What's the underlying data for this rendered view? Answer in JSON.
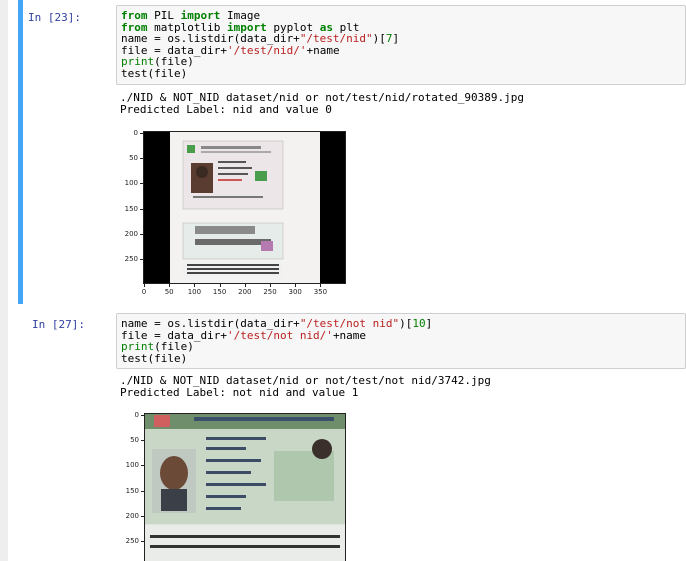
{
  "cells": [
    {
      "prompt": "In [23]:",
      "code_lines": [
        [
          {
            "t": "from",
            "c": "kw"
          },
          {
            "t": " PIL "
          },
          {
            "t": "import",
            "c": "kw"
          },
          {
            "t": " Image"
          }
        ],
        [
          {
            "t": "from",
            "c": "kw"
          },
          {
            "t": " matplotlib "
          },
          {
            "t": "import",
            "c": "kw"
          },
          {
            "t": " pyplot "
          },
          {
            "t": "as",
            "c": "kw"
          },
          {
            "t": " plt"
          }
        ],
        [
          {
            "t": "name = os.listdir(data_dir+"
          },
          {
            "t": "\"/test/nid\"",
            "c": "str"
          },
          {
            "t": ")["
          },
          {
            "t": "7",
            "c": "num"
          },
          {
            "t": "]"
          }
        ],
        [
          {
            "t": "file = data_dir+"
          },
          {
            "t": "'/test/nid/'",
            "c": "str"
          },
          {
            "t": "+name"
          }
        ],
        [
          {
            "t": "print",
            "c": "bi"
          },
          {
            "t": "(file)"
          }
        ],
        [
          {
            "t": "test(file)"
          }
        ]
      ],
      "output_lines": [
        "./NID & NOT_NID dataset/nid or not/test/nid/rotated_90389.jpg",
        "Predicted Label: nid and value 0"
      ],
      "plot": {
        "y_ticks": [
          "0",
          "50",
          "100",
          "150",
          "200",
          "250"
        ],
        "x_ticks": [
          "0",
          "50",
          "100",
          "150",
          "200",
          "250",
          "300",
          "350"
        ],
        "image_desc_icon": "nid-card-image"
      }
    },
    {
      "prompt": "In [27]:",
      "code_lines": [
        [
          {
            "t": "name = os.listdir(data_dir+"
          },
          {
            "t": "\"/test/not nid\"",
            "c": "str"
          },
          {
            "t": ")["
          },
          {
            "t": "10",
            "c": "num"
          },
          {
            "t": "]"
          }
        ],
        [
          {
            "t": "file = data_dir+"
          },
          {
            "t": "'/test/not nid/'",
            "c": "str"
          },
          {
            "t": "+name"
          }
        ],
        [
          {
            "t": "print",
            "c": "bi"
          },
          {
            "t": "(file)"
          }
        ],
        [
          {
            "t": "test(file)"
          }
        ]
      ],
      "output_lines": [
        "./NID & NOT_NID dataset/nid or not/test/not nid/3742.jpg",
        "Predicted Label: not nid and value 1"
      ],
      "plot": {
        "y_ticks": [
          "0",
          "50",
          "100",
          "150",
          "200",
          "250"
        ],
        "image_desc_icon": "passport-image"
      }
    }
  ],
  "colors": {
    "prompt": "#303f9f",
    "selected_border": "#42a5f5",
    "keyword": "#008000",
    "string": "#ba2121"
  }
}
